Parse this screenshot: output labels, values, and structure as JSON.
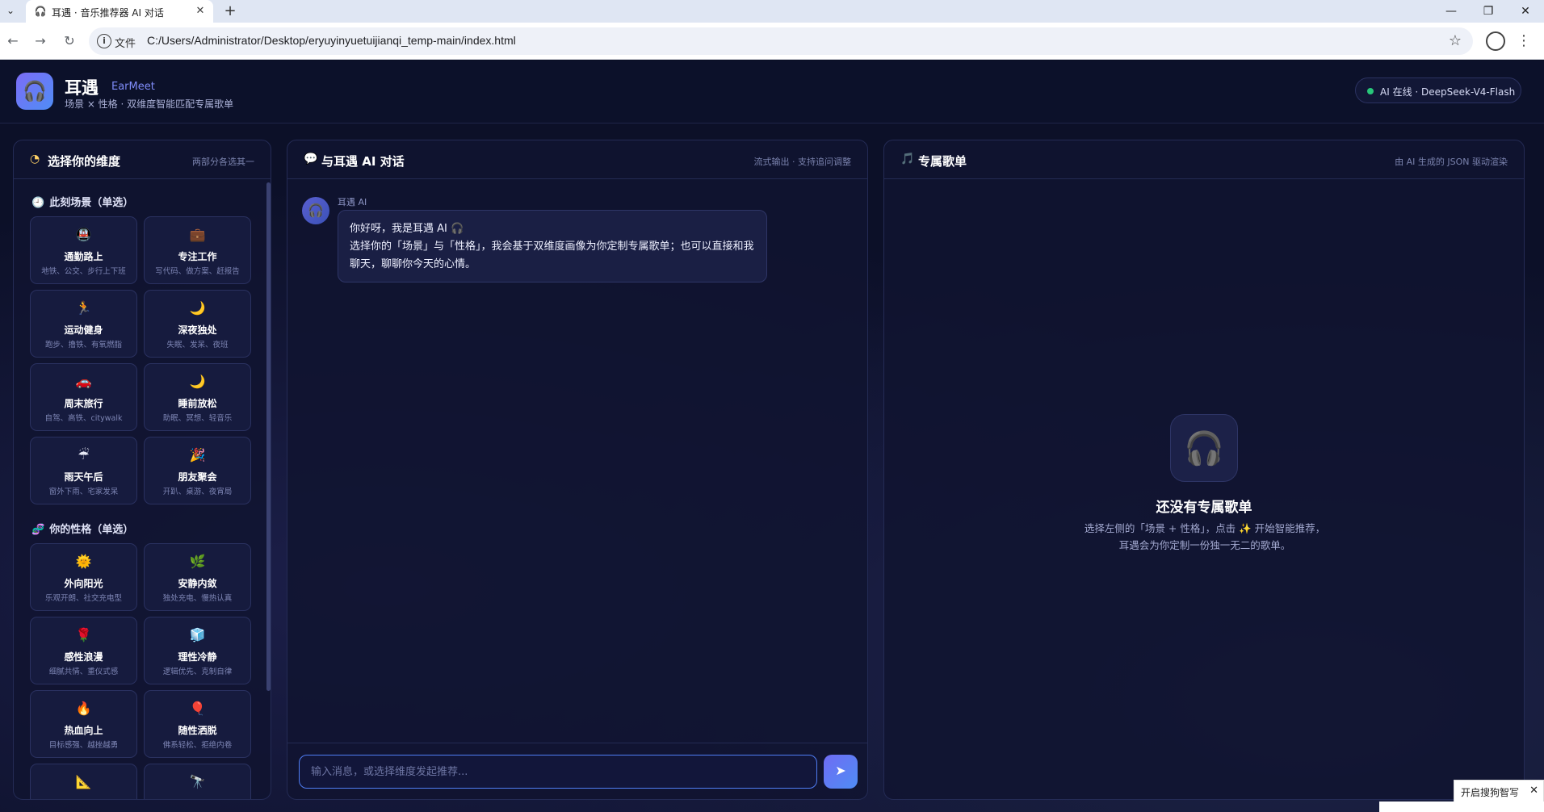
{
  "browser": {
    "tab_title": "耳遇 · 音乐推荐器 AI 对话",
    "tab_icon": "🎧",
    "address_label": "文件",
    "url": "C:/Users/Administrator/Desktop/eryuyinyuetuijianqi_temp-main/index.html"
  },
  "header": {
    "logo_icon": "🎧",
    "title": "耳遇",
    "title_en": "EarMeet",
    "subtitle": "场景 × 性格 · 双维度智能匹配专属歌单",
    "status": "AI 在线 · DeepSeek-V4-Flash"
  },
  "left_panel": {
    "icon": "◔",
    "title": "选择你的维度",
    "meta": "两部分各选其一",
    "scene_section": {
      "icon": "🕘",
      "title": "此刻场景（单选）"
    },
    "scenes": [
      {
        "emoji": "🚇",
        "title": "通勤路上",
        "desc": "地铁、公交、步行上下班"
      },
      {
        "emoji": "💼",
        "title": "专注工作",
        "desc": "写代码、做方案、赶报告"
      },
      {
        "emoji": "🏃",
        "title": "运动健身",
        "desc": "跑步、撸铁、有氧燃脂"
      },
      {
        "emoji": "🌙",
        "title": "深夜独处",
        "desc": "失眠、发呆、夜班"
      },
      {
        "emoji": "🚗",
        "title": "周末旅行",
        "desc": "自驾、高铁、citywalk"
      },
      {
        "emoji": "🌙",
        "title": "睡前放松",
        "desc": "助眠、冥想、轻音乐"
      },
      {
        "emoji": "☔",
        "title": "雨天午后",
        "desc": "窗外下雨、宅家发呆"
      },
      {
        "emoji": "🎉",
        "title": "朋友聚会",
        "desc": "开趴、桌游、夜宵局"
      }
    ],
    "personality_section": {
      "icon": "🧬",
      "title": "你的性格（单选）"
    },
    "personalities": [
      {
        "emoji": "🌞",
        "title": "外向阳光",
        "desc": "乐观开朗、社交充电型"
      },
      {
        "emoji": "🌿",
        "title": "安静内敛",
        "desc": "独处充电、慢热认真"
      },
      {
        "emoji": "🌹",
        "title": "感性浪漫",
        "desc": "细腻共情、重仪式感"
      },
      {
        "emoji": "🧊",
        "title": "理性冷静",
        "desc": "逻辑优先、克制自律"
      },
      {
        "emoji": "🔥",
        "title": "热血向上",
        "desc": "目标感强、越挫越勇"
      },
      {
        "emoji": "🎈",
        "title": "随性洒脱",
        "desc": "佛系轻松、拒绝内卷"
      },
      {
        "emoji": "📐",
        "title": "",
        "desc": ""
      },
      {
        "emoji": "🔭",
        "title": "",
        "desc": ""
      }
    ]
  },
  "chat_panel": {
    "icon": "💬",
    "title": "与耳遇 AI 对话",
    "meta": "流式输出 · 支持追问调整",
    "avatar_icon": "🎧",
    "ai_name": "耳遇 AI",
    "message_line1": "你好呀，我是耳遇 AI 🎧",
    "message_line2": "选择你的「场景」与「性格」，我会基于双维度画像为你定制专属歌单；也可以直接和我聊天，聊聊你今天的心情。",
    "input_placeholder": "输入消息，或选择维度发起推荐...",
    "send_icon": "➤"
  },
  "playlist_panel": {
    "icon": "🎵",
    "title": "专属歌单",
    "meta": "由 AI 生成的 JSON 驱动渲染",
    "empty_icon": "🎧",
    "empty_title": "还没有专属歌单",
    "empty_desc": "选择左侧的「场景 + 性格」，点击 ✨ 开始智能推荐，耳遇会为你定制一份独一无二的歌单。"
  },
  "ime": {
    "toast": "开启搜狗智写"
  }
}
